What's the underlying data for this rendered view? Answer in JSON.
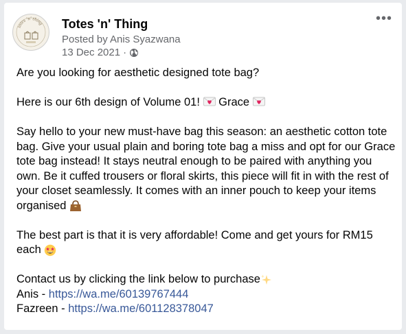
{
  "post": {
    "page_name": "Totes 'n' Thing",
    "posted_by": "Posted by Anis Syazwana",
    "date": "13 Dec 2021",
    "date_separator": "·",
    "more_label": "•••",
    "avatar_logo_text": "totes 'n' thing",
    "avatar_icon": "tote-bag-logo",
    "privacy_icon": "globe-icon"
  },
  "content": {
    "line1": "Are you looking for aesthetic designed tote bag?",
    "line2_prefix": "Here is our 6th design of Volume 01!",
    "line2_name": "Grace",
    "paragraph3": "Say hello to your new must-have bag this season: an aesthetic cotton tote bag. Give your usual plain and boring tote bag a miss and opt for our Grace tote bag instead! It stays neutral enough to be paired with anything you own. Be it cuffed trousers or floral skirts, this piece will fit in with the rest of your closet seamlessly. It comes with an inner pouch to keep your items organised",
    "paragraph4": "The best part is that it is very affordable! Come and get yours for RM15 each",
    "contact_line": "Contact us by clicking the link below to purchase",
    "contacts": [
      {
        "name": "Anis - ",
        "link": "https://wa.me/60139767444"
      },
      {
        "name": "Fazreen - ",
        "link": "https://wa.me/601128378047"
      }
    ],
    "emojis": [
      "love-letter-icon",
      "handbag-icon",
      "star-struck-icon",
      "sparkles-icon"
    ]
  },
  "colors": {
    "link": "#385898",
    "secondary_text": "#65676b",
    "background": "#e9ebee"
  }
}
